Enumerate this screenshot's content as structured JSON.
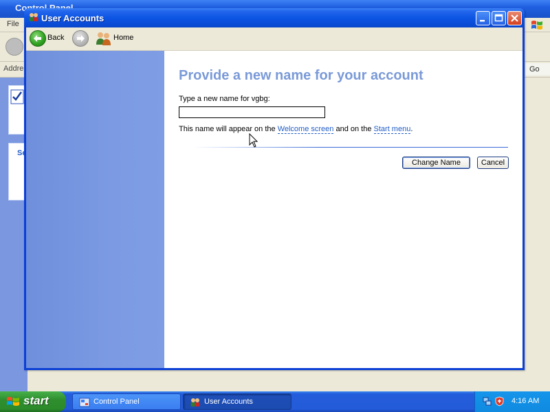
{
  "background_window": {
    "title": "Control Panel",
    "menu_file": "File",
    "address_label": "Address",
    "go_label": "Go",
    "sidebar_heading_fragment": "Se"
  },
  "window": {
    "title": "User Accounts",
    "nav": {
      "back_label": "Back",
      "home_label": "Home"
    }
  },
  "page": {
    "heading": "Provide a new name for your account",
    "field_label": "Type a new name for vgbg:",
    "name_value": "",
    "info_prefix": "This name will appear on the ",
    "welcome_link": "Welcome screen",
    "info_middle": " and on the ",
    "start_menu_link": "Start menu",
    "info_suffix": ".",
    "change_button": "Change Name",
    "cancel_button": "Cancel"
  },
  "taskbar": {
    "start_label": "start",
    "tasks": [
      {
        "label": "Control Panel",
        "active": false
      },
      {
        "label": "User Accounts",
        "active": true
      }
    ],
    "clock": "4:16 AM"
  },
  "colors": {
    "titlebar_blue": "#0a4bd6",
    "heading_blue": "#7a9ad8",
    "link_blue": "#215dc6",
    "start_green": "#2f8f2f"
  }
}
